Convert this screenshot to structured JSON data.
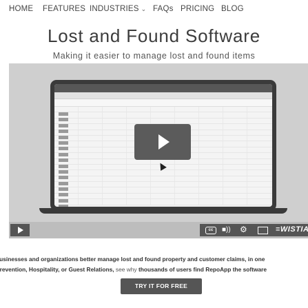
{
  "nav": {
    "edge_glyph": ")",
    "items": [
      "HOME",
      "FEATURES",
      "INDUSTRIES",
      "FAQs",
      "PRICING",
      "BLOG"
    ],
    "dropdown_icon": "chevron-down-icon"
  },
  "hero": {
    "title": "Lost and Found Software",
    "subtitle": "Making it easier to manage lost and found items"
  },
  "video": {
    "controls": {
      "cc_label": "cc",
      "volume_icon": "volume-icon",
      "settings_icon": "gear-icon",
      "fullscreen_icon": "fullscreen-icon",
      "brand_text": "WISTIA"
    }
  },
  "description": {
    "line1_start": "businesses and organizations better manage lost and found property and customer claims, in one",
    "line2_a": " Prevention, Hospitality, or Guest Relations, ",
    "line2_b": "see why",
    "line2_c": " thousands of users find RepoApp the software"
  },
  "cta": {
    "label": "TRY IT FOR FREE"
  },
  "colors": {
    "accent": "#555555",
    "video_bg": "#cfcfcf"
  }
}
